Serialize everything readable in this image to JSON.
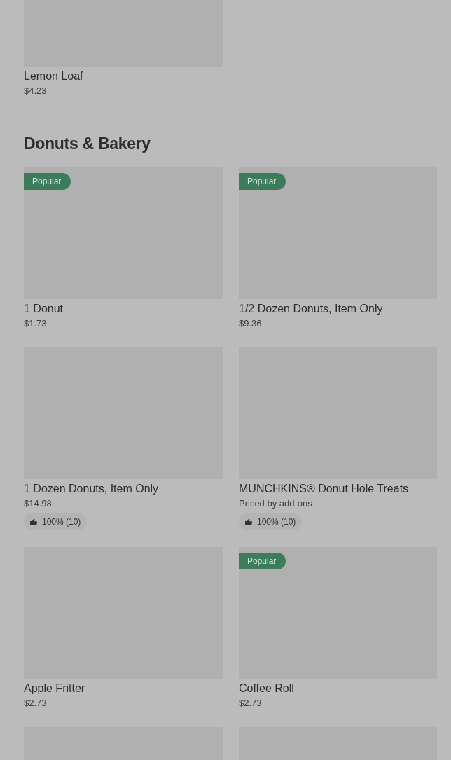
{
  "sections": [
    {
      "rows": [
        {
          "items": [
            {
              "kind": "product",
              "name": "Lemon Loaf",
              "price": "$4.23"
            }
          ]
        }
      ]
    },
    {
      "title": "Donuts & Bakery",
      "rows": [
        {
          "items": [
            {
              "kind": "product",
              "name": "1 Donut",
              "price": "$1.73",
              "badge": "Popular"
            },
            {
              "kind": "product",
              "name": "1/2 Dozen Donuts, Item Only",
              "price": "$9.36",
              "badge": "Popular"
            }
          ]
        },
        {
          "items": [
            {
              "kind": "product",
              "name": "1 Dozen Donuts, Item Only",
              "price": "$14.98",
              "rating": "100% (10)"
            },
            {
              "kind": "product",
              "name": "MUNCHKINS® Donut Hole Treats",
              "price": "Priced by add-ons",
              "rating": "100% (10)"
            }
          ]
        },
        {
          "items": [
            {
              "kind": "product",
              "name": "Apple Fritter",
              "price": "$2.73"
            },
            {
              "kind": "product",
              "name": "Coffee Roll",
              "price": "$2.73",
              "badge": "Popular"
            }
          ]
        },
        {
          "items": [
            {
              "kind": "placeholder"
            },
            {
              "kind": "placeholder"
            }
          ]
        }
      ]
    }
  ]
}
